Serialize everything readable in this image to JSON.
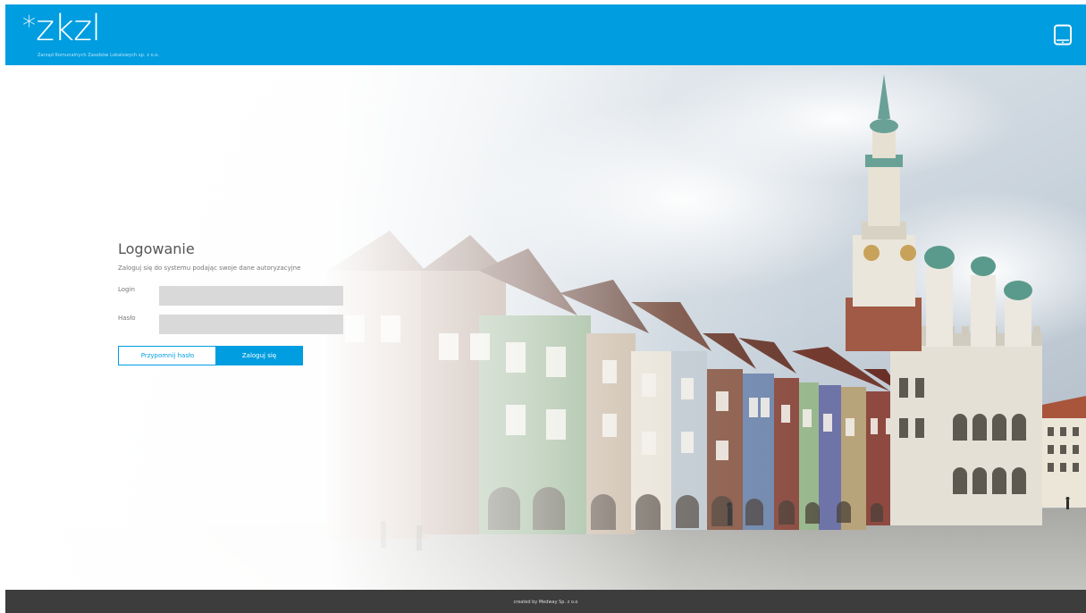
{
  "header": {
    "logo_text": "zkzl",
    "logo_star": "*",
    "logo_subtitle": "Zarząd Komunalnych Zasobów Lokalowych sp. z o.o.",
    "tablet_icon": "tablet-icon"
  },
  "login": {
    "title": "Logowanie",
    "subtitle": "Zaloguj się do systemu podając swoje dane autoryzacyjne",
    "login_label": "Login",
    "login_value": "",
    "password_label": "Hasło",
    "password_value": "",
    "remind_button": "Przypomnij hasło",
    "submit_button": "Zaloguj się"
  },
  "footer": {
    "text": "created by Medway Sp. z o.o"
  },
  "colors": {
    "brand": "#009de0",
    "footer": "#3d3d3d",
    "input_bg": "#d9d9d9"
  }
}
